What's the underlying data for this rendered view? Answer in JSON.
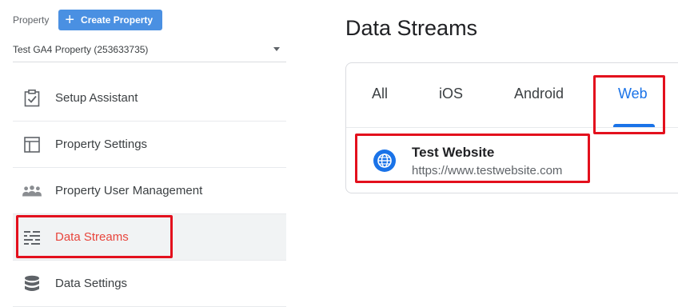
{
  "property": {
    "label": "Property",
    "create_button": "Create Property",
    "selected": "Test GA4 Property (253633735)"
  },
  "menu": {
    "items": [
      {
        "label": "Setup Assistant",
        "icon": "checklist-icon"
      },
      {
        "label": "Property Settings",
        "icon": "layout-icon"
      },
      {
        "label": "Property User Management",
        "icon": "people-icon"
      },
      {
        "label": "Data Streams",
        "icon": "streams-icon",
        "active": true
      },
      {
        "label": "Data Settings",
        "icon": "database-icon"
      }
    ]
  },
  "main": {
    "title": "Data Streams",
    "tabs": [
      "All",
      "iOS",
      "Android",
      "Web"
    ],
    "active_tab": "Web",
    "stream": {
      "name": "Test Website",
      "url": "https://www.testwebsite.com",
      "icon": "globe-icon"
    }
  },
  "colors": {
    "accent": "#1a73e8",
    "button": "#4a90e2",
    "active_text": "#e8453c",
    "highlight_box": "#e3101d"
  }
}
